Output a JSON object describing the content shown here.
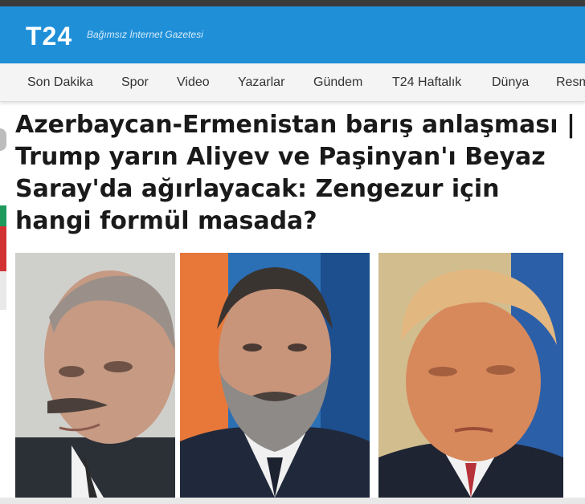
{
  "header": {
    "logo": "T24",
    "tagline": "Bağımsız İnternet Gazetesi"
  },
  "nav": {
    "items": [
      {
        "label": "Son Dakika"
      },
      {
        "label": "Spor"
      },
      {
        "label": "Video"
      },
      {
        "label": "Yazarlar"
      },
      {
        "label": "Gündem"
      },
      {
        "label": "T24 Haftalık"
      },
      {
        "label": "Dünya"
      },
      {
        "label": "Resm"
      }
    ]
  },
  "article": {
    "headline": "Azerbaycan-Ermenistan barış anlaşması | Trump yarın Aliyev ve Paşinyan'ı Beyaz Saray'da ağırlayacak: Zengezur için hangi formül masada?"
  },
  "photos": [
    {
      "subject": "aliyev-portrait"
    },
    {
      "subject": "pashinyan-portrait"
    },
    {
      "subject": "trump-portrait"
    }
  ],
  "colors": {
    "header_blue": "#1f8fd8",
    "nav_bg": "#f4f4f4",
    "headline_text": "#1a1a1a"
  }
}
